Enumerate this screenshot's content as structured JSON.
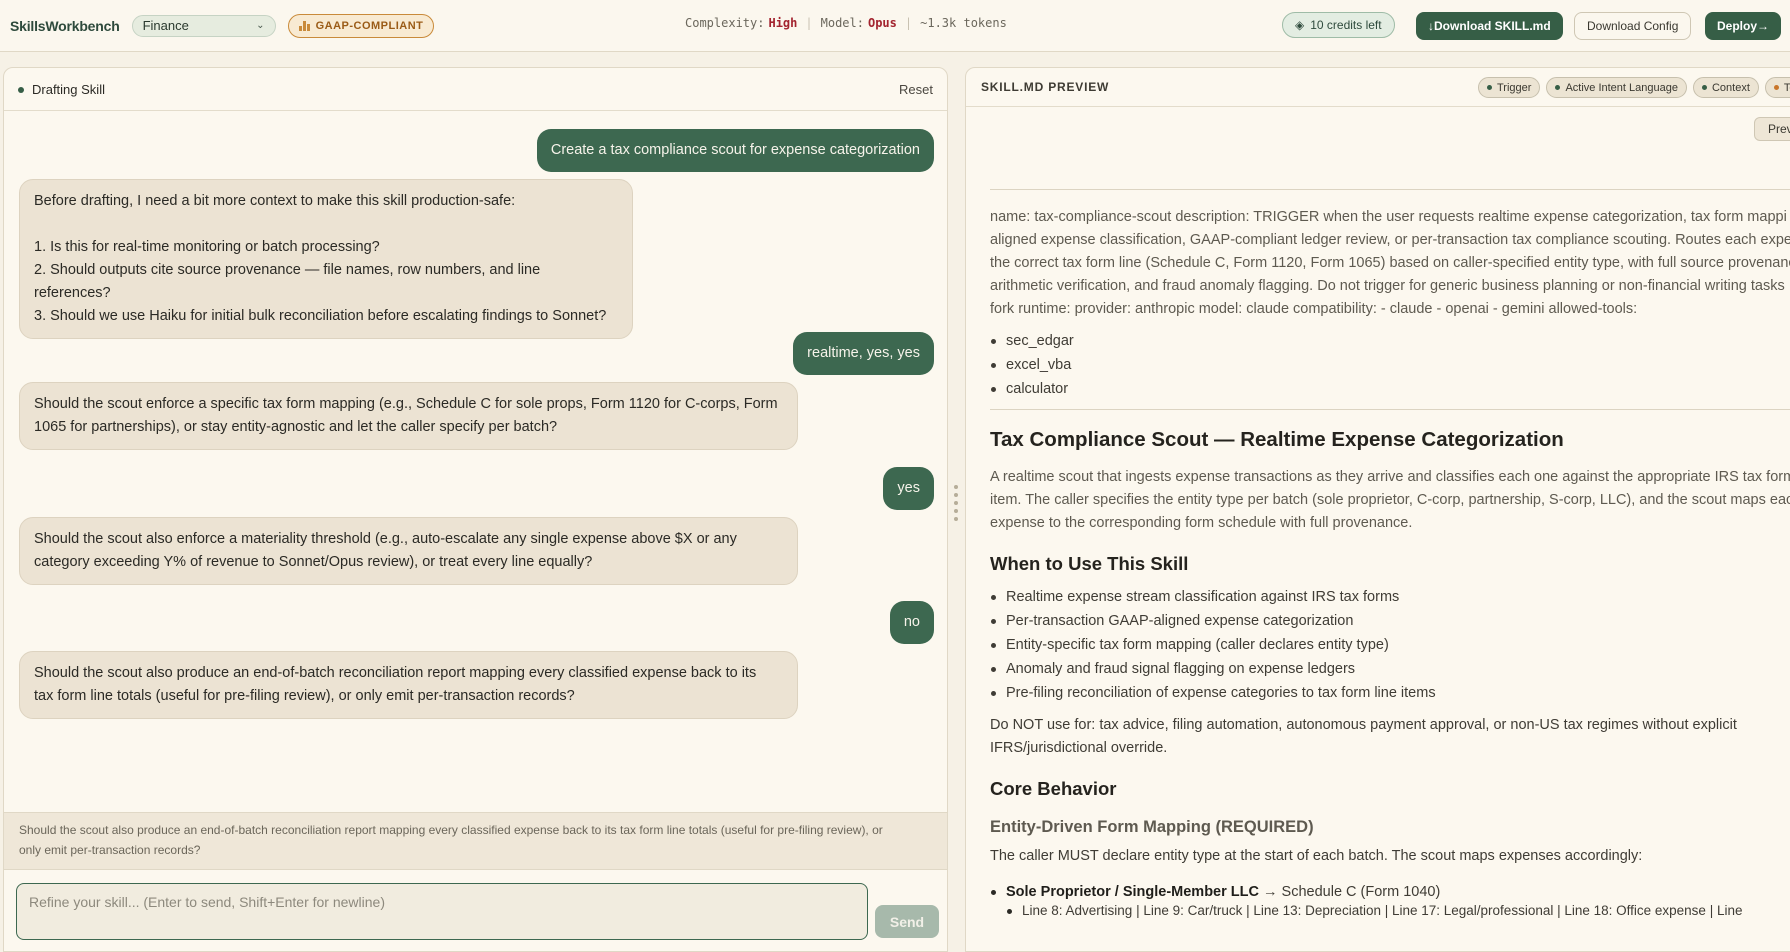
{
  "topbar": {
    "brand": "SkillsWorkbench",
    "domain_select": "Finance",
    "compliance_badge": "GAAP-COMPLIANT",
    "complexity_label": "Complexity:",
    "complexity_value": "High",
    "model_label": "Model:",
    "model_value": "Opus",
    "tokens": "~1.3k tokens",
    "credits": "10 credits left",
    "download_skill": "↓Download SKILL.md",
    "download_config": "Download Config",
    "deploy": "Deploy→"
  },
  "left_panel": {
    "status": "Drafting Skill",
    "reset": "Reset",
    "messages": [
      {
        "role": "user",
        "text": "Create a tax compliance scout for expense categorization"
      },
      {
        "role": "assistant",
        "lines": [
          "Before drafting, I need a bit more context to make this skill production-safe:",
          "",
          "1. Is this for real-time monitoring or batch processing?",
          "2. Should outputs cite source provenance — file names, row numbers, and line references?",
          "3. Should we use Haiku for initial bulk reconciliation before escalating findings to Sonnet?"
        ]
      },
      {
        "role": "user",
        "text": "realtime, yes, yes"
      },
      {
        "role": "assistant",
        "lines": [
          "Should the scout enforce a specific tax form mapping (e.g., Schedule C for sole props, Form 1120 for C-corps, Form",
          "1065 for partnerships), or stay entity-agnostic and let the caller specify per batch?"
        ]
      },
      {
        "role": "user",
        "text": "yes"
      },
      {
        "role": "assistant",
        "lines": [
          "Should the scout also enforce a materiality threshold (e.g., auto-escalate any single expense above $X or any",
          "category exceeding Y% of revenue to Sonnet/Opus review), or treat every line equally?"
        ]
      },
      {
        "role": "user",
        "text": "no"
      },
      {
        "role": "assistant",
        "lines": [
          "Should the scout also produce an end-of-batch reconciliation report mapping every classified expense back to its",
          "tax form line totals (useful for pre-filing review), or only emit per-transaction records?"
        ]
      }
    ],
    "pending_question": [
      "Should the scout also produce an end-of-batch reconciliation report mapping every classified expense back to its tax form line totals (useful for pre-filing review), or",
      "only emit per-transaction records?"
    ],
    "composer_placeholder": "Refine your skill... (Enter to send, Shift+Enter for newline)",
    "send": "Send"
  },
  "right_panel": {
    "title": "SKILL.MD PREVIEW",
    "tags": [
      "Trigger",
      "Active Intent Language",
      "Context",
      "To"
    ],
    "preview_button": "Prev",
    "frontmatter": [
      "name: tax-compliance-scout description: TRIGGER when the user requests realtime expense categorization, tax form mappi",
      "aligned expense classification, GAAP-compliant ledger review, or per-transaction tax compliance scouting. Routes each expe",
      "the correct tax form line (Schedule C, Form 1120, Form 1065) based on caller-specified entity type, with full source provenanc",
      "arithmetic verification, and fraud anomaly flagging. Do not trigger for generic business planning or non-financial writing tasks",
      "fork runtime: provider: anthropic model: claude compatibility: - claude - openai - gemini allowed-tools:"
    ],
    "tools": [
      "sec_edgar",
      "excel_vba",
      "calculator"
    ],
    "h1": "Tax Compliance Scout — Realtime Expense Categorization",
    "intro": [
      "A realtime scout that ingests expense transactions as they arrive and classifies each one against the appropriate IRS tax form",
      "item. The caller specifies the entity type per batch (sole proprietor, C-corp, partnership, S-corp, LLC), and the scout maps each",
      "expense to the corresponding form schedule with full provenance."
    ],
    "when_heading": "When to Use This Skill",
    "when_items": [
      "Realtime expense stream classification against IRS tax forms",
      "Per-transaction GAAP-aligned expense categorization",
      "Entity-specific tax form mapping (caller declares entity type)",
      "Anomaly and fraud signal flagging on expense ledgers",
      "Pre-filing reconciliation of expense categories to tax form line items"
    ],
    "not_for": [
      "Do NOT use for: tax advice, filing automation, autonomous payment approval, or non-US tax regimes without explicit",
      "IFRS/jurisdictional override."
    ],
    "core_heading": "Core Behavior",
    "mapping_heading": "Entity-Driven Form Mapping (REQUIRED)",
    "mapping_intro": "The caller MUST declare entity type at the start of each batch. The scout maps expenses accordingly:",
    "entity_name": "Sole Proprietor / Single-Member LLC",
    "entity_arrow": " → Schedule C (Form 1040)",
    "entity_lines": "Line 8: Advertising | Line 9: Car/truck | Line 13: Depreciation | Line 17: Legal/professional | Line 18: Office expense | Line"
  }
}
